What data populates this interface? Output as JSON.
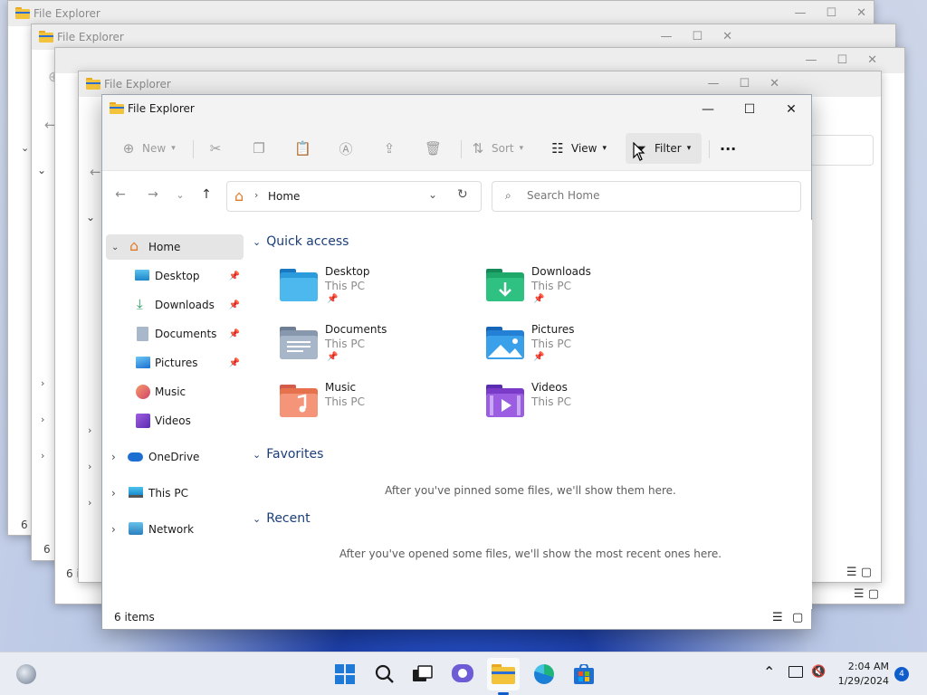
{
  "window": {
    "title": "File Explorer",
    "minimize": "—",
    "maximize": "☐",
    "close": "✕"
  },
  "background_windows": [
    {
      "title": "File Explorer",
      "count": "6 i"
    },
    {
      "title": "File Explorer",
      "count": "6 items"
    },
    {
      "title": "File Explorer",
      "count": "6 i"
    },
    {
      "title": "File Explorer",
      "count": "6 i"
    }
  ],
  "toolbar": {
    "new_label": "New",
    "sort_label": "Sort",
    "view_label": "View",
    "filter_label": "Filter",
    "more_label": "···"
  },
  "address": {
    "current": "Home"
  },
  "search": {
    "placeholder": "Search Home"
  },
  "sidebar": {
    "items": [
      {
        "label": "Home"
      },
      {
        "label": "Desktop"
      },
      {
        "label": "Downloads"
      },
      {
        "label": "Documents"
      },
      {
        "label": "Pictures"
      },
      {
        "label": "Music"
      },
      {
        "label": "Videos"
      },
      {
        "label": "OneDrive"
      },
      {
        "label": "This PC"
      },
      {
        "label": "Network"
      }
    ]
  },
  "content": {
    "quick_access_title": "Quick access",
    "favorites_title": "Favorites",
    "recent_title": "Recent",
    "favorites_empty": "After you've pinned some files, we'll show them here.",
    "recent_empty": "After you've opened some files, we'll show the most recent ones here.",
    "quick_access": [
      {
        "name": "Desktop",
        "location": "This PC"
      },
      {
        "name": "Downloads",
        "location": "This PC"
      },
      {
        "name": "Documents",
        "location": "This PC"
      },
      {
        "name": "Pictures",
        "location": "This PC"
      },
      {
        "name": "Music",
        "location": "This PC"
      },
      {
        "name": "Videos",
        "location": "This PC"
      }
    ]
  },
  "statusbar": {
    "item_count": "6 items"
  },
  "taskbar": {
    "time": "2:04 AM",
    "date": "1/29/2024",
    "notification_count": "4"
  },
  "colors": {
    "accent": "#0f5ccb",
    "section_heading": "#1a3e7a",
    "folder_yellow": "#f3c33b"
  }
}
